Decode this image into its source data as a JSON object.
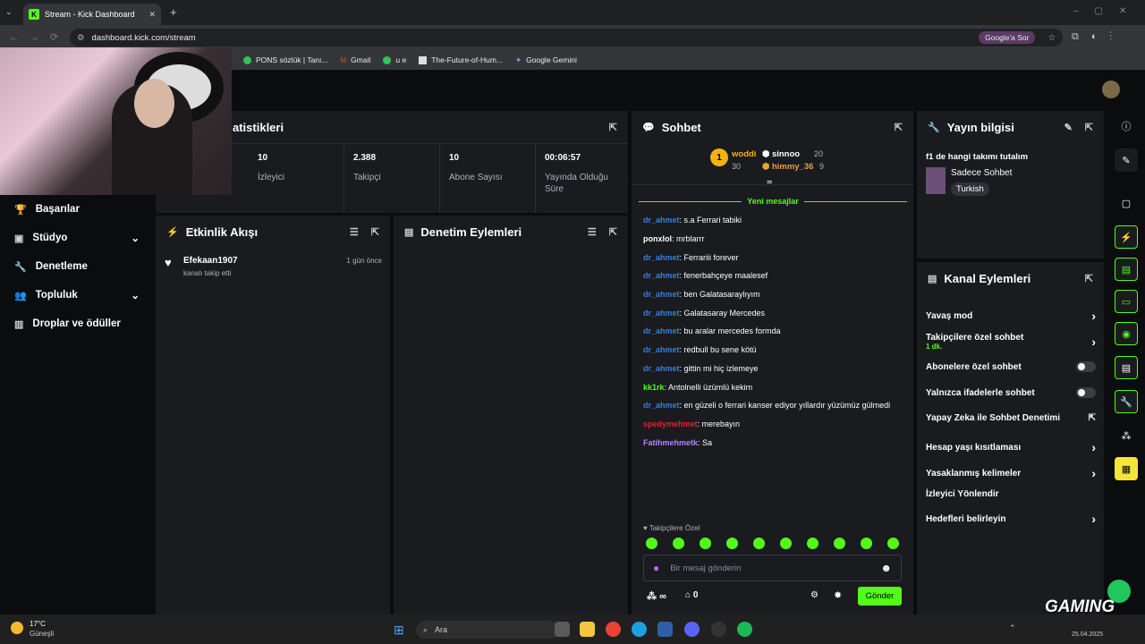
{
  "browser": {
    "tab_title": "Stream - Kick Dashboard",
    "url": "dashboard.kick.com/stream",
    "google_button": "Google'a Sor",
    "bookmarks": [
      "PONS sözlük | Tanı...",
      "Gmail",
      "u e",
      "The-Future-of-Hum...",
      "Google Gemini"
    ]
  },
  "stats": {
    "title": "atistikleri",
    "items": [
      {
        "value": "10",
        "label": "İzleyici"
      },
      {
        "value": "2.388",
        "label": "Takipçi"
      },
      {
        "value": "10",
        "label": "Abone Sayısı"
      },
      {
        "value": "00:06:57",
        "label": "Yayında Olduğu Süre"
      }
    ]
  },
  "nav": {
    "items": [
      "Başarılar",
      "Stüdyo",
      "Denetleme",
      "Topluluk",
      "Droplar ve ödüller"
    ]
  },
  "activity": {
    "title": "Etkinlik Akışı",
    "event_user": "Efekaan1907",
    "event_text": "kanalı takip etti",
    "event_time": "1 gün önce"
  },
  "moderation": {
    "title": "Denetim Eylemleri"
  },
  "chat": {
    "title": "Sohbet",
    "top": [
      {
        "rank": "1",
        "name": "woddi",
        "count": "30"
      },
      {
        "name": "sinnoo",
        "count": "20"
      },
      {
        "name": "himmy_36",
        "count": "9"
      }
    ],
    "new_messages": "Yeni mesajlar",
    "messages": [
      {
        "user": "dr_ahmet",
        "text": ": s.a Ferrari tabiki",
        "color": "#3d7dd8"
      },
      {
        "user": "ponxlol",
        "text": ": mrblarrr",
        "color": "#ffffff"
      },
      {
        "user": "dr_ahmet",
        "text": ": Ferrariii forever",
        "color": "#3d7dd8"
      },
      {
        "user": "dr_ahmet",
        "text": ": fenerbahçeye maalesef",
        "color": "#3d7dd8"
      },
      {
        "user": "dr_ahmet",
        "text": ": ben Galatasaraylıyım",
        "color": "#3d7dd8"
      },
      {
        "user": "dr_ahmet",
        "text": ": Galatasaray Mercedes",
        "color": "#3d7dd8"
      },
      {
        "user": "dr_ahmet",
        "text": ": bu aralar mercedes formda",
        "color": "#3d7dd8"
      },
      {
        "user": "dr_ahmet",
        "text": ": redbull bu sene kötü",
        "color": "#3d7dd8"
      },
      {
        "user": "dr_ahmet",
        "text": ": gittin mi hiç izlemeye",
        "color": "#3d7dd8"
      },
      {
        "user": "kk1rk",
        "text": ": Antolnelli üzümlü kekim",
        "color": "#53fc18"
      },
      {
        "user": "dr_ahmet",
        "text": ": en güzeli o ferrari kanser ediyor yıllardır yüzümüz gülmedi",
        "color": "#3d7dd8"
      },
      {
        "user": "spedymehmet",
        "text": ": merebayın",
        "color": "#e0242c"
      },
      {
        "user": "Fatihmehmetk",
        "text": ": Sa",
        "color": "#b184ff"
      }
    ],
    "followers_only": "Takipçilere Özel",
    "placeholder": "Bir mesaj gönderin",
    "points": "∞",
    "store_count": "0",
    "send": "Gönder"
  },
  "stream_info": {
    "title": "Yayın bilgisi",
    "stream_title": "f1 de hangi takımı tutalım",
    "category": "Sadece Sohbet",
    "tag": "Turkish"
  },
  "channel_actions": {
    "title": "Kanal Eylemleri",
    "items": [
      {
        "label": "Yavaş mod",
        "sub": "",
        "control": "chevron"
      },
      {
        "label": "Takipçilere özel sohbet",
        "sub": "1 dk.",
        "control": "chevron"
      },
      {
        "label": "Abonelere özel sohbet",
        "sub": "",
        "control": "toggle"
      },
      {
        "label": "Yalnızca ifadelerle sohbet",
        "sub": "",
        "control": "toggle"
      },
      {
        "label": "Yapay Zeka ile Sohbet Denetimi",
        "sub": "",
        "control": "external"
      },
      {
        "label": "Hesap yaşı kısıtlaması",
        "sub": "",
        "control": "chevron"
      },
      {
        "label": "Yasaklanmış kelimeler",
        "sub": "",
        "control": "chevron"
      },
      {
        "label": "İzleyici Yönlendir",
        "sub": "",
        "control": "none"
      },
      {
        "label": "Hedefleri belirleyin",
        "sub": "",
        "control": "chevron"
      }
    ]
  },
  "taskbar": {
    "weather_temp": "17°C",
    "weather_desc": "Güneşli",
    "search": "Ara",
    "time": "25.04.2025"
  },
  "overlay": {
    "brand": "GAMING"
  }
}
